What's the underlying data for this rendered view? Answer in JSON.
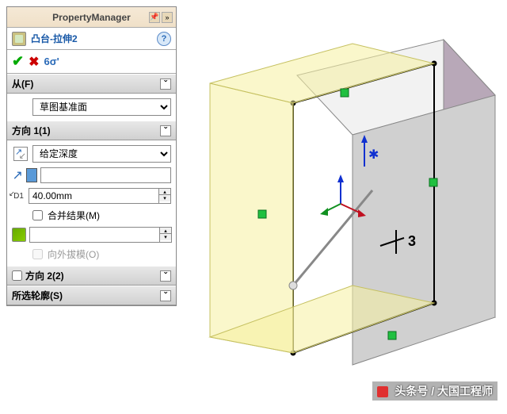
{
  "panel_title": "PropertyManager",
  "feature_name": "凸台-拉伸2",
  "sections": {
    "from": {
      "label": "从(F)",
      "start_condition": "草图基准面"
    },
    "dir1": {
      "label": "方向 1(1)",
      "end_condition": "给定深度",
      "depth": "40.00mm",
      "merge_label": "合并结果(M)",
      "merge_checked": false,
      "draft_label": "向外拔模(O)",
      "draft_enabled": false
    },
    "dir2": {
      "label": "方向 2(2)"
    },
    "contours": {
      "label": "所选轮廓(S)"
    }
  },
  "dimension_callout": "3",
  "watermark": "头条号 / 大国工程师",
  "colors": {
    "preview_face": "#f5f0a0",
    "preview_edge": "#c5c060",
    "solid_top": "#f2f2f2",
    "solid_front": "#d0d0d0",
    "solid_side": "#b8a8b8",
    "handle_green": "#20c040"
  }
}
